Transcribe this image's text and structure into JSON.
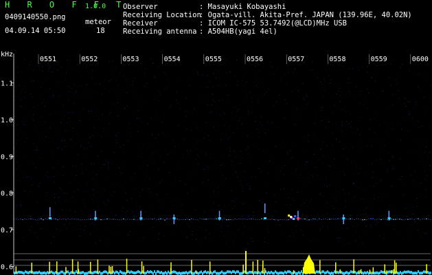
{
  "header": {
    "app_title": "H R O F F T",
    "version": "1.0.0",
    "filename": "0409140550.png",
    "meteor_label": "meteor",
    "datetime": "04.09.14 05:50",
    "meteor_count": "18"
  },
  "info": [
    {
      "key": "Observer",
      "value": ": Masayuki Kobayashi"
    },
    {
      "key": "Receiving Location",
      "value": ": Ogata-vill. Akita-Pref. JAPAN (139.96E, 40.02N)"
    },
    {
      "key": "Receiver",
      "value": ": ICOM IC-575 53.7492(@LCD)MHz USB"
    },
    {
      "key": "Receiving antenna",
      "value": ": A504HB(yagi 4el)"
    }
  ],
  "colors": {
    "accent_green": "#4cff4c",
    "background": "#000000",
    "noise_blue": "#1a1a66",
    "signal_yellow": "#ffff00",
    "baseline_cyan": "#33ccff"
  },
  "chart_data": {
    "type": "heatmap",
    "xlabel": "",
    "ylabel": "kHz",
    "x_ticks": [
      "0551",
      "0552",
      "0553",
      "0554",
      "0555",
      "0556",
      "0557",
      "0558",
      "0559",
      "0600"
    ],
    "y_ticks": [
      "1.1",
      "1.0",
      "0.9",
      "0.8",
      "0.7",
      "0.6"
    ],
    "ylim": [
      0.58,
      1.18
    ],
    "signal_band_khz": 0.73,
    "meteor_echoes": [
      {
        "time": "0551",
        "khz": 0.75
      },
      {
        "time": "0552",
        "khz": 0.74
      },
      {
        "time": "0553",
        "khz": 0.74
      },
      {
        "time": "0554",
        "khz": 0.73
      },
      {
        "time": "0555",
        "khz": 0.74
      },
      {
        "time": "0556",
        "khz": 0.76
      },
      {
        "time": "0557",
        "khz": 0.74
      },
      {
        "time": "0558",
        "khz": 0.73
      },
      {
        "time": "0559",
        "khz": 0.74
      }
    ]
  }
}
